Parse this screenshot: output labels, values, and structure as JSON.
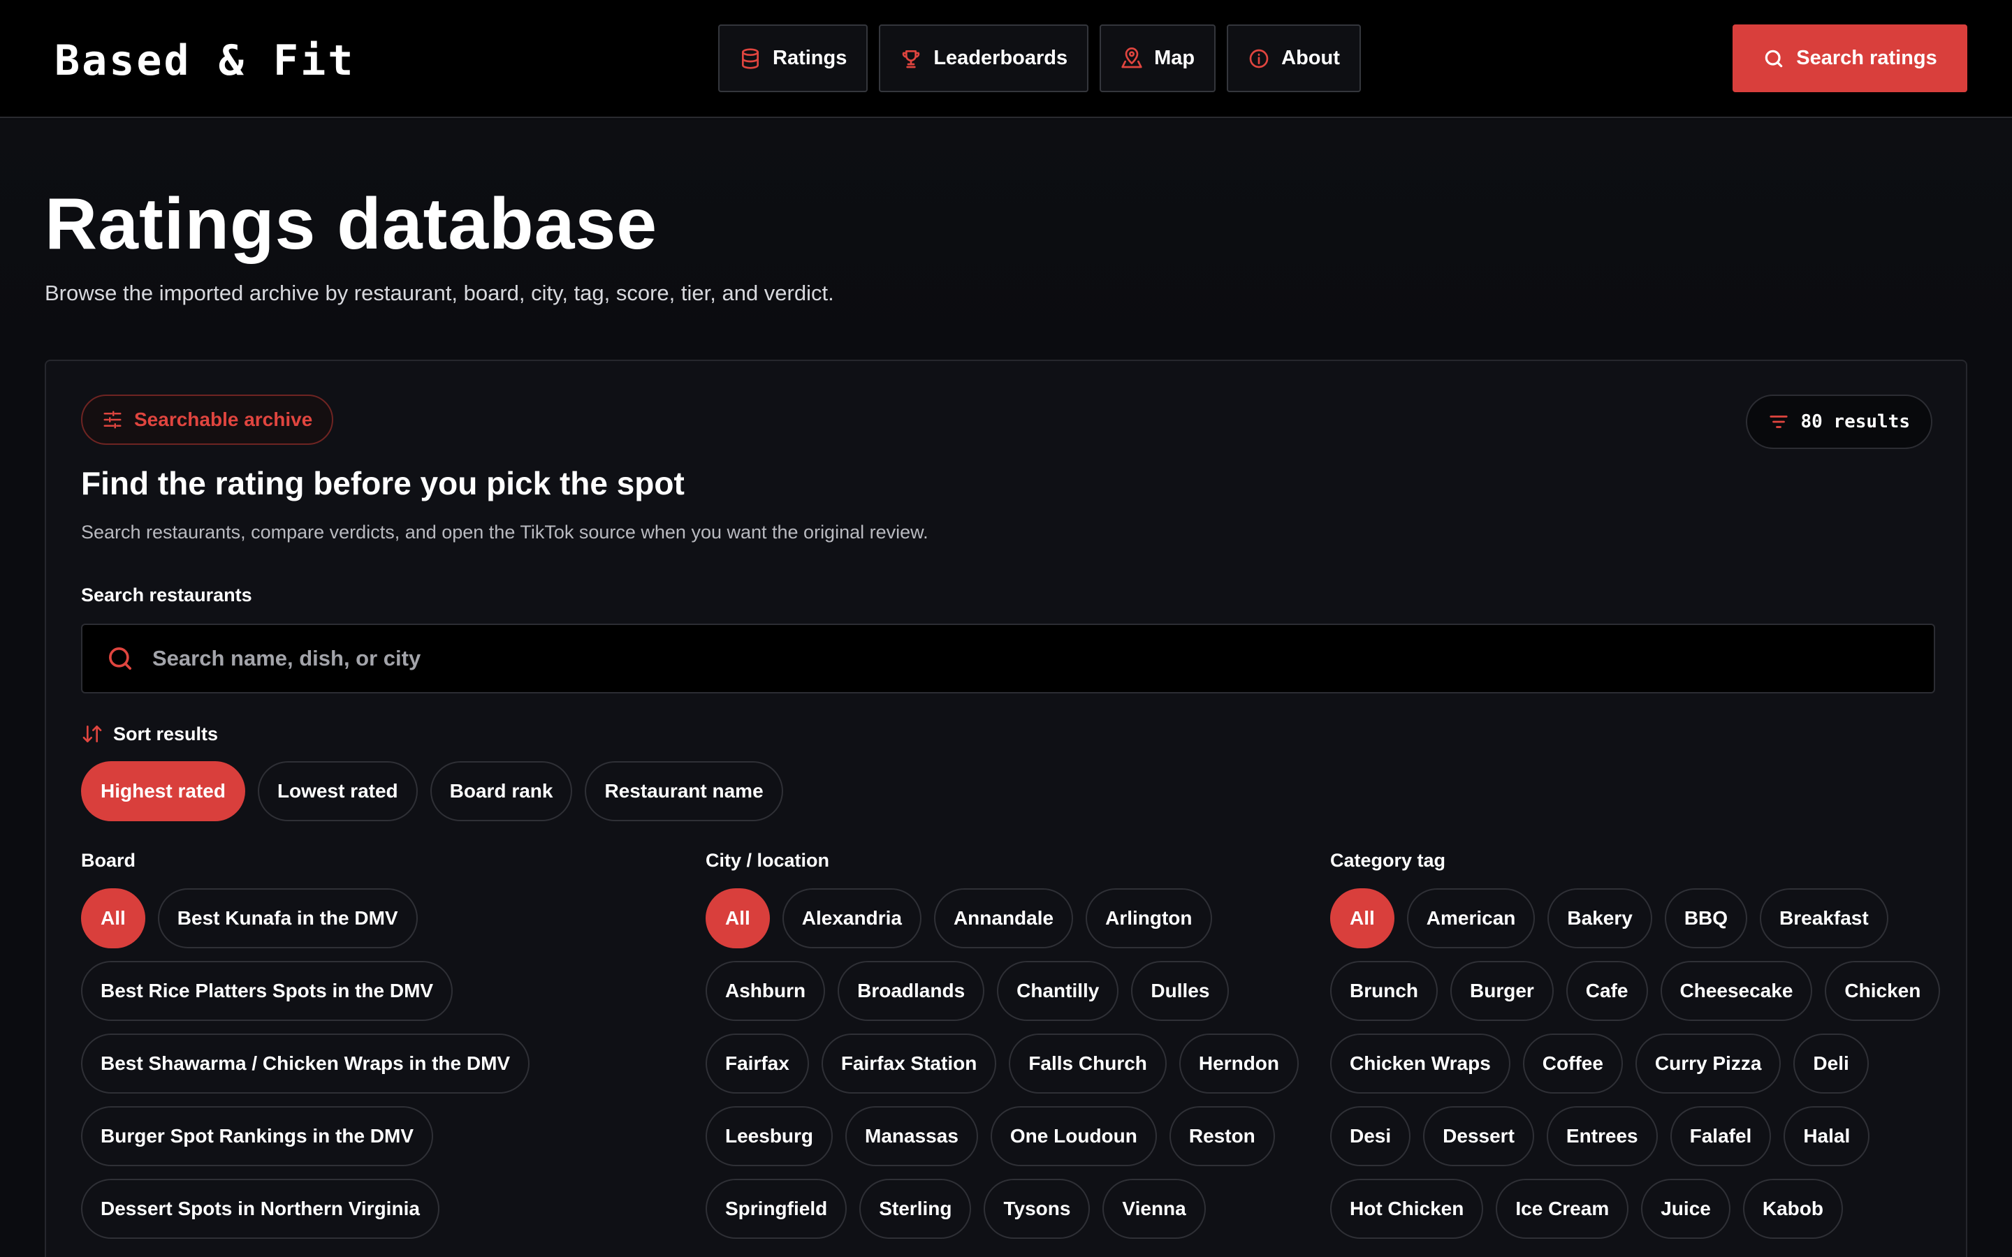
{
  "header": {
    "logo": "Based & Fit",
    "nav": [
      {
        "label": "Ratings",
        "icon": "database-icon"
      },
      {
        "label": "Leaderboards",
        "icon": "trophy-icon"
      },
      {
        "label": "Map",
        "icon": "map-pin-icon"
      },
      {
        "label": "About",
        "icon": "info-icon"
      }
    ],
    "search_cta": "Search ratings"
  },
  "page": {
    "title": "Ratings database",
    "subtitle": "Browse the imported archive by restaurant, board, city, tag, score, tier, and verdict."
  },
  "card": {
    "badge": "Searchable archive",
    "results": "80 results",
    "title": "Find the rating before you pick the spot",
    "subtitle": "Search restaurants, compare verdicts, and open the TikTok source when you want the original review.",
    "search_label": "Search restaurants",
    "search_placeholder": "Search name, dish, or city",
    "search_value": "",
    "sort_label": "Sort results",
    "sort_options": [
      "Highest rated",
      "Lowest rated",
      "Board rank",
      "Restaurant name"
    ],
    "sort_selected": 0
  },
  "filters": {
    "board": {
      "label": "Board",
      "options": [
        "All",
        "Best Kunafa in the DMV",
        "Best Rice Platters Spots in the DMV",
        "Best Shawarma / Chicken Wraps in the DMV",
        "Burger Spot Rankings in the DMV",
        "Dessert Spots in Northern Virginia"
      ]
    },
    "city": {
      "label": "City / location",
      "options": [
        "All",
        "Alexandria",
        "Annandale",
        "Arlington",
        "Ashburn",
        "Broadlands",
        "Chantilly",
        "Dulles",
        "Fairfax",
        "Fairfax Station",
        "Falls Church",
        "Herndon",
        "Leesburg",
        "Manassas",
        "One Loudoun",
        "Reston",
        "Springfield",
        "Sterling",
        "Tysons",
        "Vienna"
      ]
    },
    "category": {
      "label": "Category tag",
      "options": [
        "All",
        "American",
        "Bakery",
        "BBQ",
        "Breakfast",
        "Brunch",
        "Burger",
        "Cafe",
        "Cheesecake",
        "Chicken",
        "Chicken Wraps",
        "Coffee",
        "Curry Pizza",
        "Deli",
        "Desi",
        "Dessert",
        "Entrees",
        "Falafel",
        "Halal",
        "Hot Chicken",
        "Ice Cream",
        "Juice",
        "Kabob"
      ]
    }
  },
  "colors": {
    "accent": "#d93f3c",
    "background": "#0b0c10",
    "header": "#000000"
  }
}
